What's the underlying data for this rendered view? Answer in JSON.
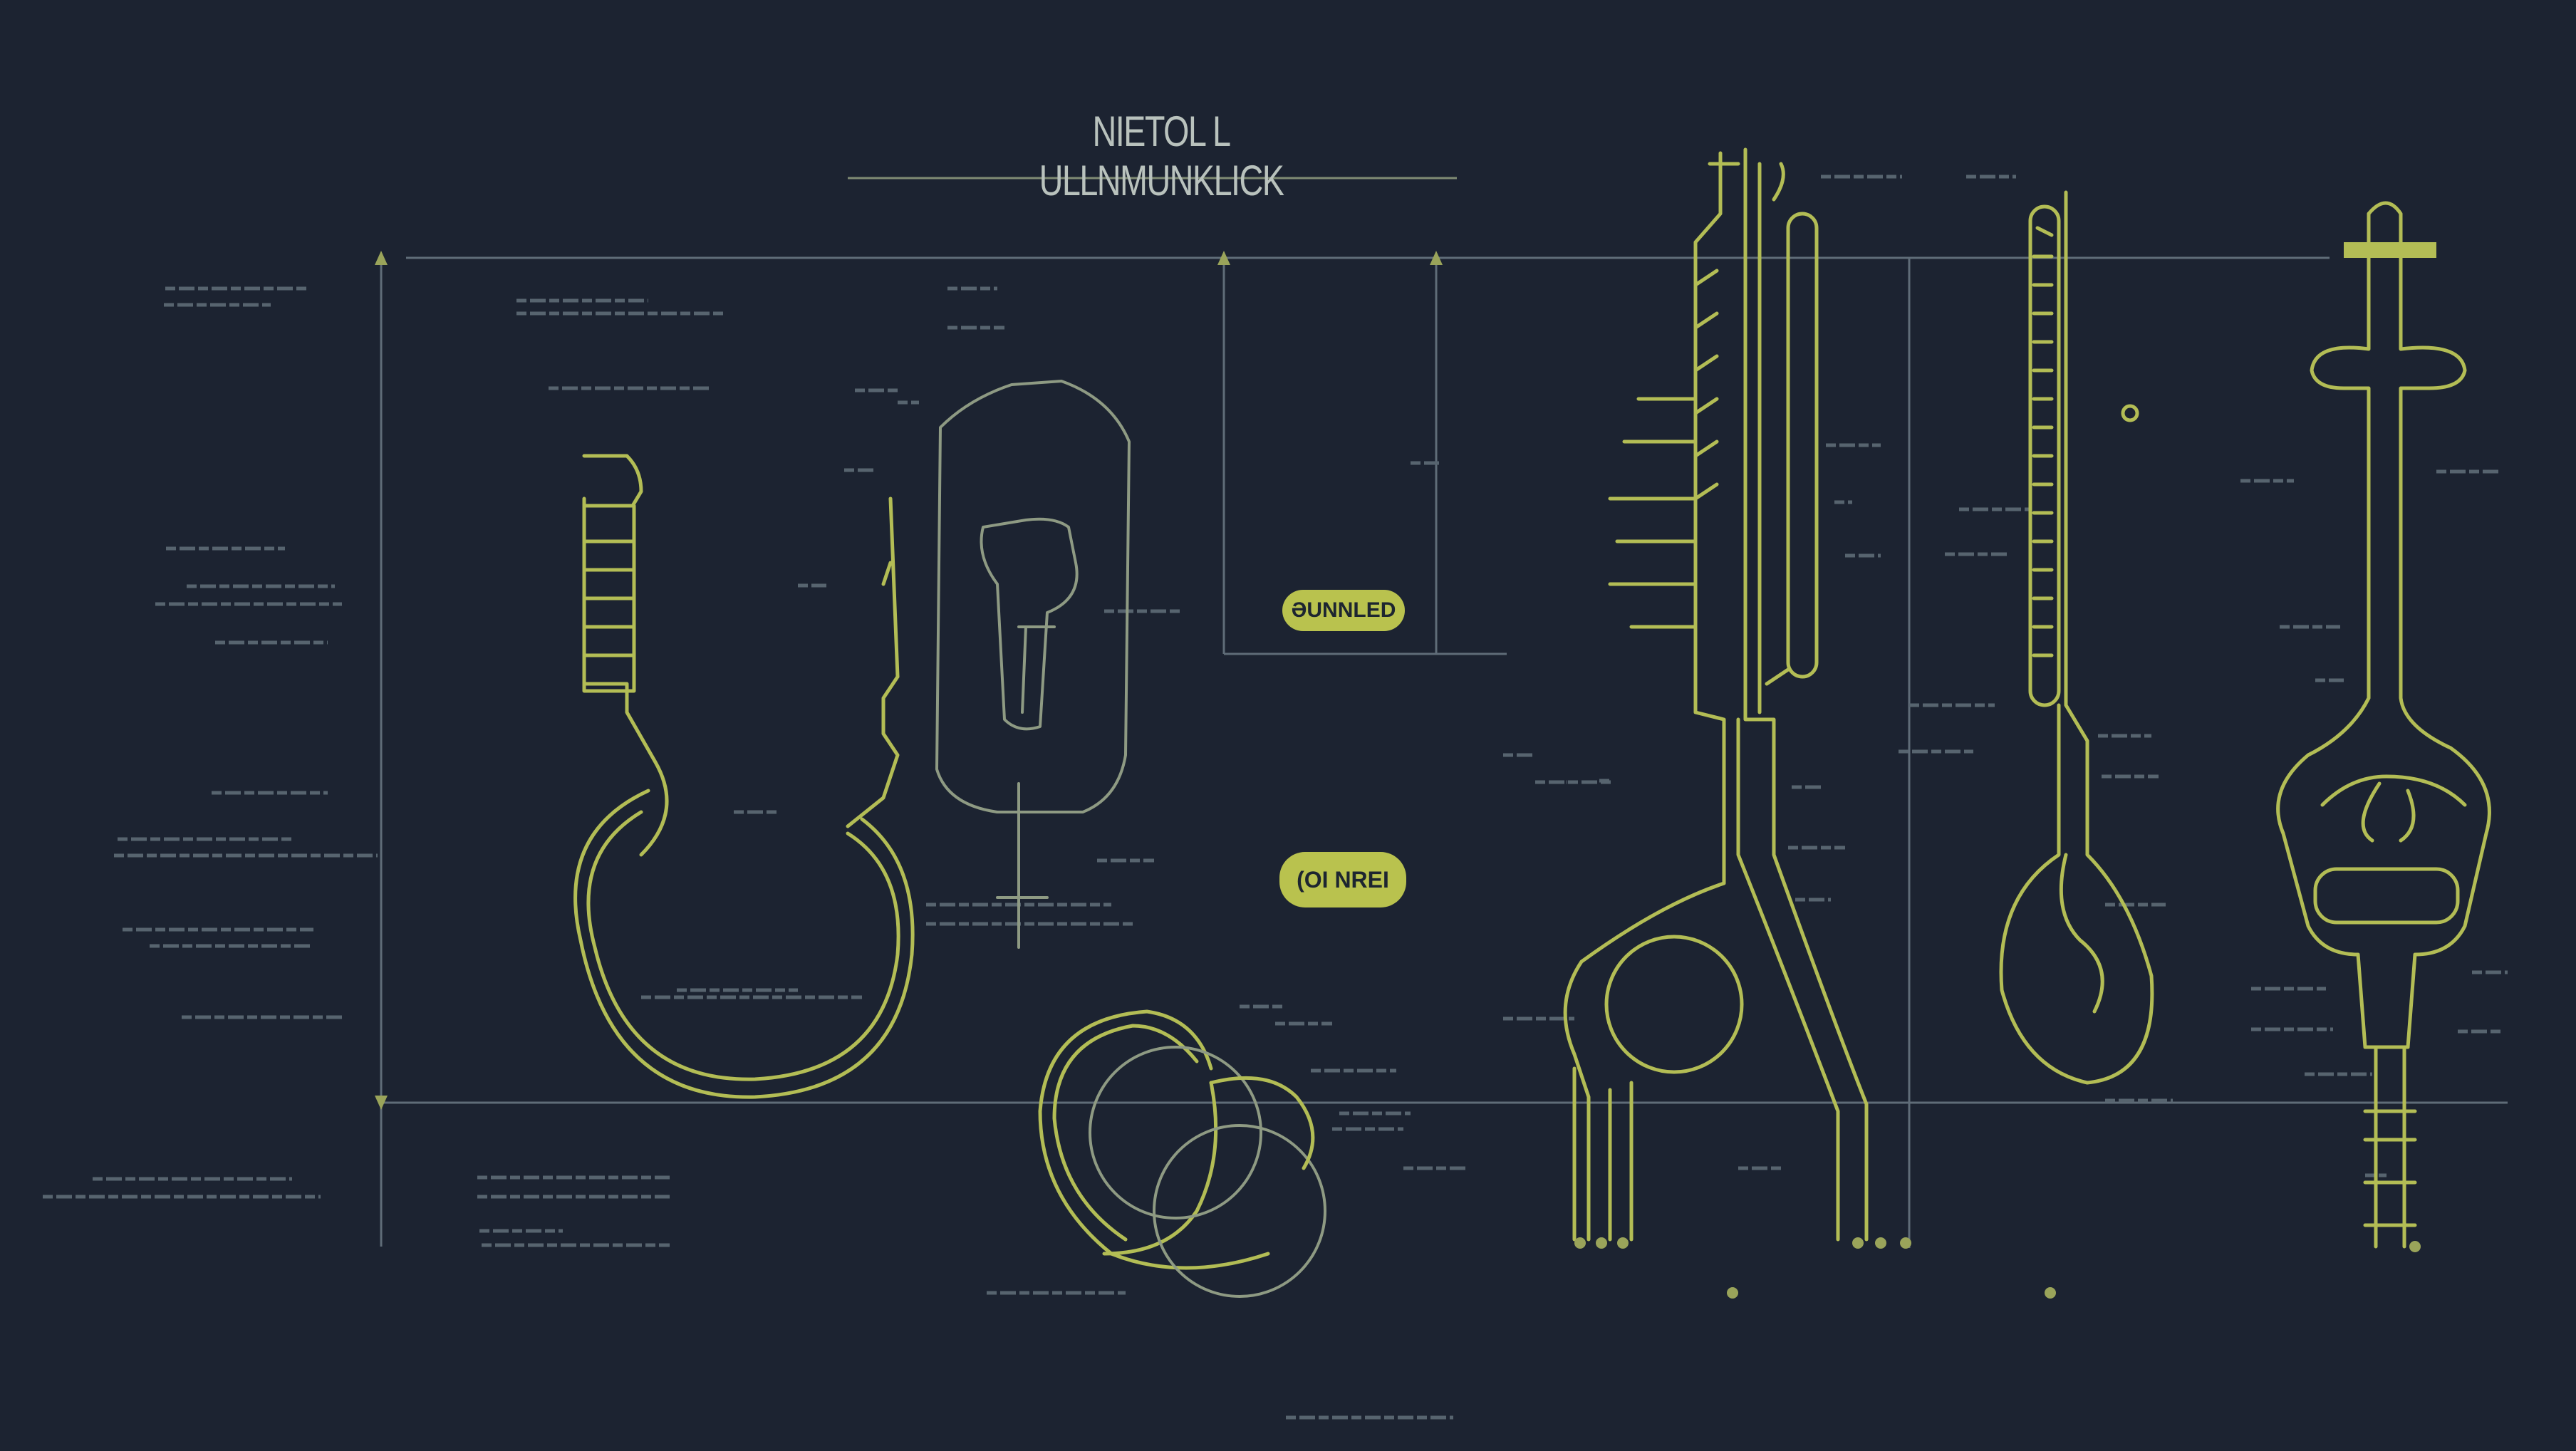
{
  "diagram": {
    "title": "NIETOL L ULLNMUNKLICK",
    "labels": [
      {
        "id": "badge-1",
        "text": "ƏUNNLED"
      },
      {
        "id": "badge-2",
        "text": "(OI NREI"
      }
    ]
  },
  "colors": {
    "background": "#1c2331",
    "accent": "#b9c24e",
    "guide": "#6f7c86",
    "annotation": "#5d6a76"
  }
}
